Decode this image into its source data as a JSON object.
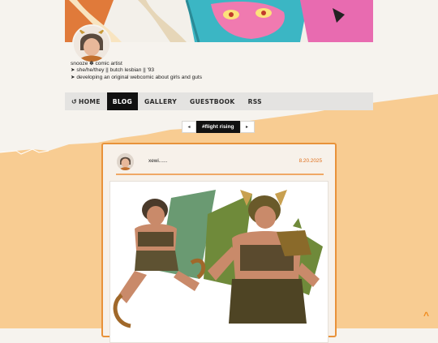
{
  "colors": {
    "accent": "#e8923a",
    "date": "#e0701c",
    "orange_bg": "#f8cc92",
    "nav_active": "#111111"
  },
  "profile": {
    "bio_lines": [
      "snooze ✽ comic artist",
      "➤ she/he/they || butch lesbian || '93",
      "➤ developing an original webcomic about girls and guts"
    ]
  },
  "nav": {
    "home_icon": "↺",
    "home": "HOME",
    "blog": "BLOG",
    "gallery": "GALLERY",
    "guestbook": "GUESTBOOK",
    "rss": "RSS"
  },
  "pager": {
    "prev": "◂",
    "tag": "#flight rising",
    "next": "▸"
  },
  "post": {
    "user": "xewi......",
    "date": "8.20.2025"
  },
  "scroll_top": "^"
}
